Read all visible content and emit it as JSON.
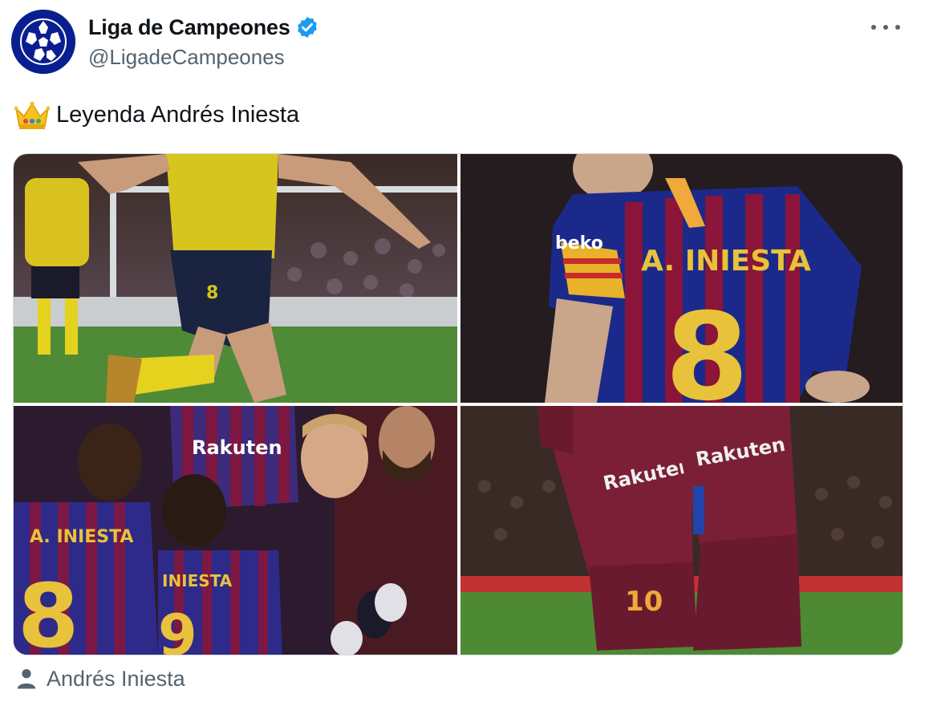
{
  "account": {
    "display_name": "Liga de Campeones",
    "handle": "@LigadeCampeones",
    "verified": true,
    "avatar_icon": "champions-league-ball-icon"
  },
  "header": {
    "more_icon": "more-options-icon"
  },
  "tweet": {
    "emoji": "crown-icon",
    "text": "Leyenda Andrés Iniesta"
  },
  "media": {
    "photos": [
      {
        "description_icon": "player-yellow-kit"
      },
      {
        "jersey_name": "A. INIESTA",
        "jersey_number": "8",
        "sponsor": "beko"
      },
      {
        "sponsor": "Rakuten",
        "jersey_name": "A. INIESTA",
        "jersey_number": "8",
        "second_jersey_name": "INIESTA",
        "second_jersey_number": "9"
      },
      {
        "sponsor_left": "Rakuten",
        "sponsor_right": "Rakuten",
        "jersey_number": "10"
      }
    ]
  },
  "tagged": {
    "icon": "person-icon",
    "name": "Andrés Iniesta"
  },
  "colors": {
    "text_primary": "#0f1419",
    "text_secondary": "#536471",
    "verified_blue": "#1d9bf0",
    "avatar_bg": "#0a1f8f",
    "barca_blue": "#1b2a8a",
    "barca_garnet": "#8a1538",
    "kit_yellow": "#e8d22a"
  }
}
